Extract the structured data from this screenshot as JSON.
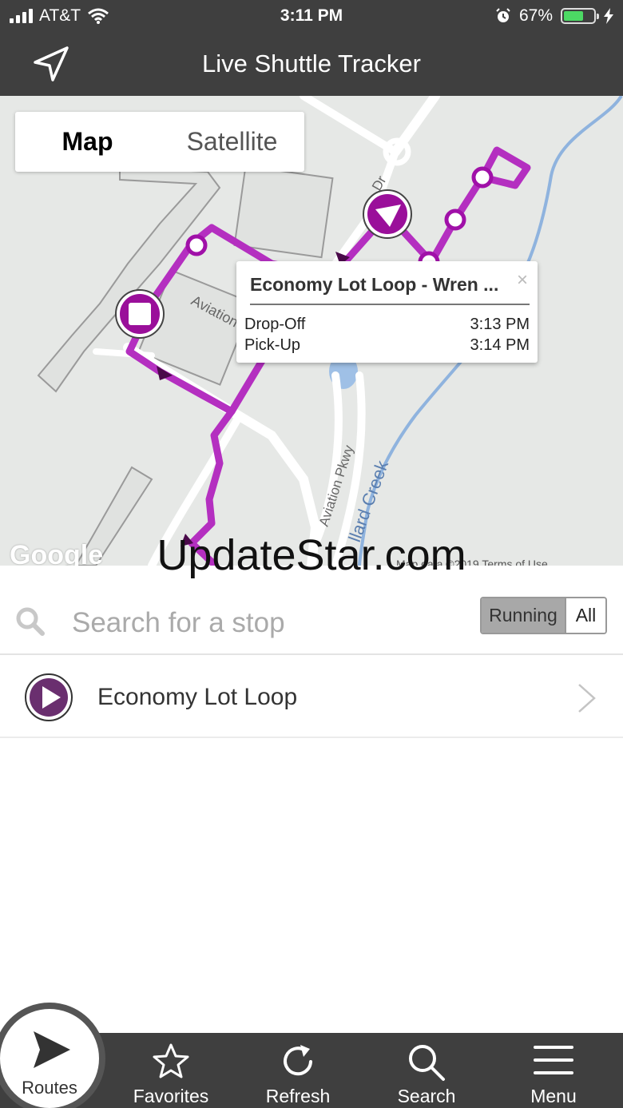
{
  "status_bar": {
    "carrier": "AT&T",
    "time": "3:11 PM",
    "battery_percent": "67%",
    "battery_level": 0.67
  },
  "header": {
    "title": "Live Shuttle Tracker",
    "location_icon": "navigation-arrow-icon"
  },
  "map": {
    "toggle": {
      "map_label": "Map",
      "satellite_label": "Satellite",
      "selected": "Map"
    },
    "road_labels": [
      "Aviation",
      "Aviation Pkwy",
      "llard Creek",
      "Dr"
    ],
    "info_window": {
      "title": "Economy Lot Loop - Wren ...",
      "rows": [
        {
          "label": "Drop-Off",
          "time": "3:13 PM"
        },
        {
          "label": "Pick-Up",
          "time": "3:14 PM"
        }
      ],
      "close_label": "×"
    },
    "google_logo": "Google",
    "footer_text": "Map data ©2019   Terms of Use",
    "watermark": "UpdateStar.com",
    "route_color": "#b42fc0",
    "marker_color": "#9a0f9a"
  },
  "search": {
    "placeholder": "Search for a stop",
    "value": "",
    "filter": {
      "running_label": "Running",
      "all_label": "All",
      "selected": "Running"
    }
  },
  "routes": [
    {
      "name": "Economy Lot Loop",
      "icon": "play-circle-icon",
      "color": "#6a2f6f"
    }
  ],
  "bottom_nav": [
    {
      "label": "Routes",
      "icon": "play-triangle-icon",
      "active": true
    },
    {
      "label": "Favorites",
      "icon": "star-icon"
    },
    {
      "label": "Refresh",
      "icon": "refresh-icon"
    },
    {
      "label": "Search",
      "icon": "search-icon"
    },
    {
      "label": "Menu",
      "icon": "hamburger-menu-icon"
    }
  ]
}
